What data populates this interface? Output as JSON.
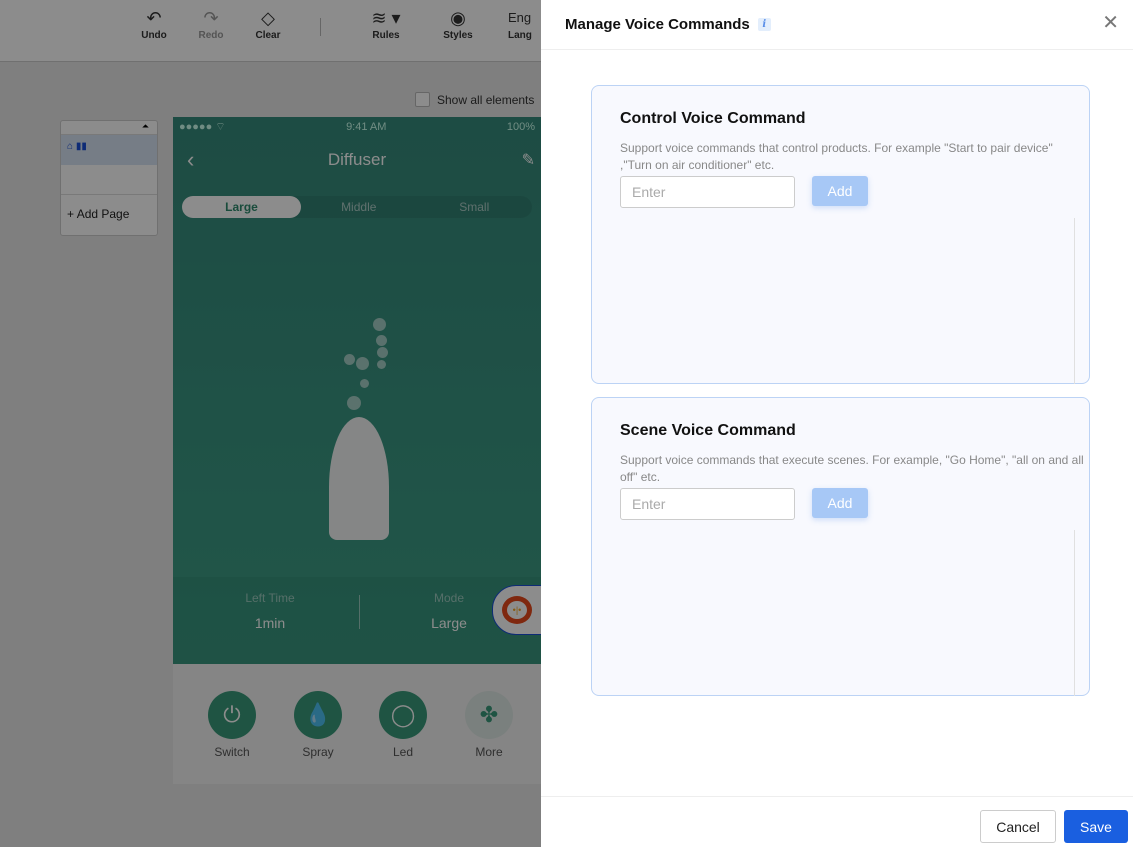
{
  "toolbar": {
    "undo": "Undo",
    "redo": "Redo",
    "clear": "Clear",
    "rules": "Rules",
    "styles": "Styles",
    "language": "Eng",
    "language_label": "Lang"
  },
  "canvas": {
    "show_all_elements": "Show all elements",
    "add_page": "Add Page"
  },
  "phone": {
    "carrier": "●●●●● ⌔",
    "time": "9:41 AM",
    "battery": "100%",
    "title": "Diffuser",
    "tabs": [
      "Large",
      "Middle",
      "Small"
    ],
    "active_tab": "Large",
    "left_time_label": "Left Time",
    "left_time_value": "1min",
    "mode_label": "Mode",
    "mode_value": "Large",
    "controls": [
      "Switch",
      "Spray",
      "Led",
      "More"
    ]
  },
  "drawer": {
    "title": "Manage Voice Commands",
    "info_icon": "i",
    "close": "✕",
    "control": {
      "title": "Control Voice Command",
      "desc": "Support voice commands that control products. For example \"Start to pair device\" ,\"Turn on air conditioner\" etc.",
      "placeholder": "Enter",
      "add": "Add"
    },
    "scene": {
      "title": "Scene Voice Command",
      "desc": "Support voice commands that execute scenes. For example, \"Go Home\", \"all on and all off\" etc.",
      "placeholder": "Enter",
      "add": "Add"
    },
    "cancel": "Cancel",
    "save": "Save"
  },
  "colors": {
    "primary": "#1a5fe0",
    "add_disabled": "#a7c8f6",
    "phone_green": "#3a9a7a"
  }
}
